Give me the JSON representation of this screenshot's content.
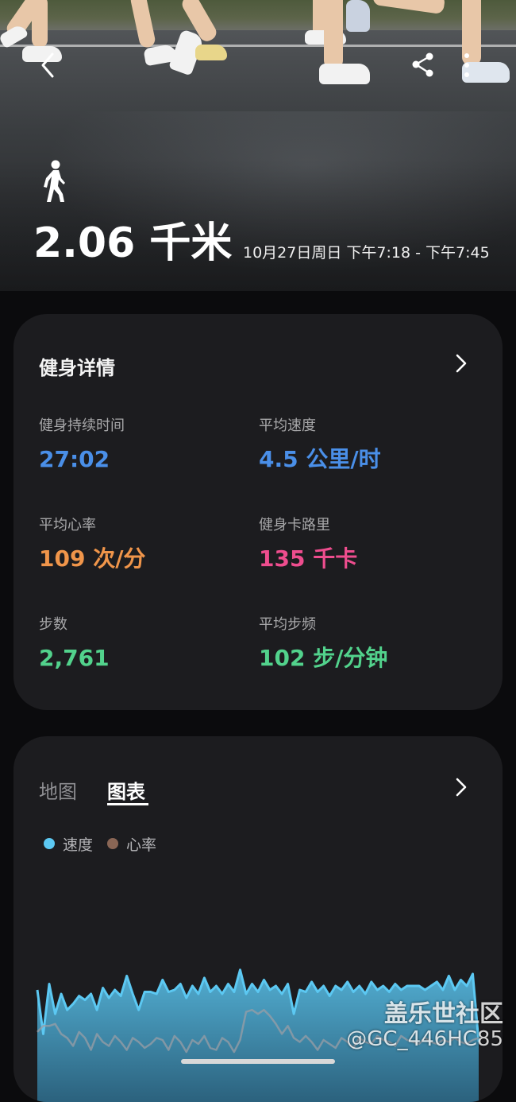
{
  "hero": {
    "distance": "2.06 千米",
    "time_range": "10月27日周日 下午7:18 - 下午7:45",
    "activity_icon": "walking-person-icon",
    "actions": [
      "back-icon",
      "share-icon",
      "more-icon"
    ]
  },
  "details": {
    "title": "健身详情",
    "stats": [
      {
        "label": "健身持续时间",
        "value": "27:02",
        "color": "#4a8fe8"
      },
      {
        "label": "平均速度",
        "value": "4.5 公里/时",
        "color": "#4a8fe8"
      },
      {
        "label": "平均心率",
        "value": "109 次/分",
        "color": "#f0954a"
      },
      {
        "label": "健身卡路里",
        "value": "135 千卡",
        "color": "#ee4d8e"
      },
      {
        "label": "步数",
        "value": "2,761",
        "color": "#52d28c"
      },
      {
        "label": "平均步频",
        "value": "102 步/分钟",
        "color": "#52d28c"
      }
    ]
  },
  "chart_card": {
    "tabs": [
      "地图",
      "图表"
    ],
    "active_tab": "图表",
    "legend": [
      {
        "name": "速度",
        "color": "#5cc8f2"
      },
      {
        "name": "心率",
        "color": "#8a6655"
      }
    ]
  },
  "chart_data": {
    "type": "area",
    "series": [
      {
        "name": "速度",
        "color": "#5cc8f2",
        "values": [
          5.6,
          3.4,
          5.9,
          4.4,
          5.4,
          4.6,
          4.9,
          5.3,
          5.1,
          5.4,
          4.6,
          5.7,
          5.2,
          5.6,
          5.3,
          6.3,
          5.4,
          4.6,
          5.5,
          5.5,
          5.4,
          6.1,
          5.5,
          5.6,
          5.9,
          5.2,
          5.8,
          5.4,
          6.2,
          5.5,
          5.8,
          5.4,
          5.9,
          5.5,
          6.6,
          5.4,
          5.9,
          5.5,
          6.1,
          5.6,
          5.8,
          5.4,
          5.9,
          4.4,
          5.6,
          5.5,
          6.0,
          5.5,
          5.8,
          5.3,
          5.8,
          5.6,
          6.0,
          5.5,
          5.8,
          5.4,
          6.0,
          5.6,
          5.8,
          5.5,
          5.9,
          5.6,
          5.8,
          5.8,
          5.8,
          5.6,
          5.8,
          6.0,
          5.6,
          6.3,
          5.6,
          6.1,
          5.8,
          6.4,
          3.0
        ]
      },
      {
        "name": "心率",
        "color": "#8a6655",
        "values": [
          3.5,
          3.8,
          3.8,
          3.9,
          3.4,
          3.2,
          2.8,
          3.5,
          3.2,
          2.6,
          3.4,
          3.0,
          2.8,
          3.3,
          3.0,
          2.6,
          3.2,
          3.0,
          2.7,
          2.9,
          3.2,
          3.1,
          2.6,
          3.3,
          3.0,
          2.5,
          3.1,
          2.9,
          3.3,
          2.7,
          2.6,
          3.2,
          3.0,
          2.5,
          3.1,
          4.5,
          4.6,
          4.4,
          4.6,
          4.3,
          3.9,
          3.4,
          3.8,
          3.2,
          3.0,
          3.3,
          3.0,
          2.6,
          3.1,
          2.9,
          2.7,
          3.2,
          3.0,
          2.7,
          3.2,
          3.0,
          2.9,
          3.3,
          3.1,
          3.0,
          2.8,
          3.3,
          3.1,
          3.0,
          2.9,
          3.2,
          3.0,
          2.9,
          3.1,
          3.0,
          3.2,
          3.0,
          2.9,
          3.1,
          3.2
        ]
      }
    ],
    "grid": false
  },
  "watermark": {
    "line1": "盖乐世社区",
    "line2": "@GC_446HC85"
  }
}
